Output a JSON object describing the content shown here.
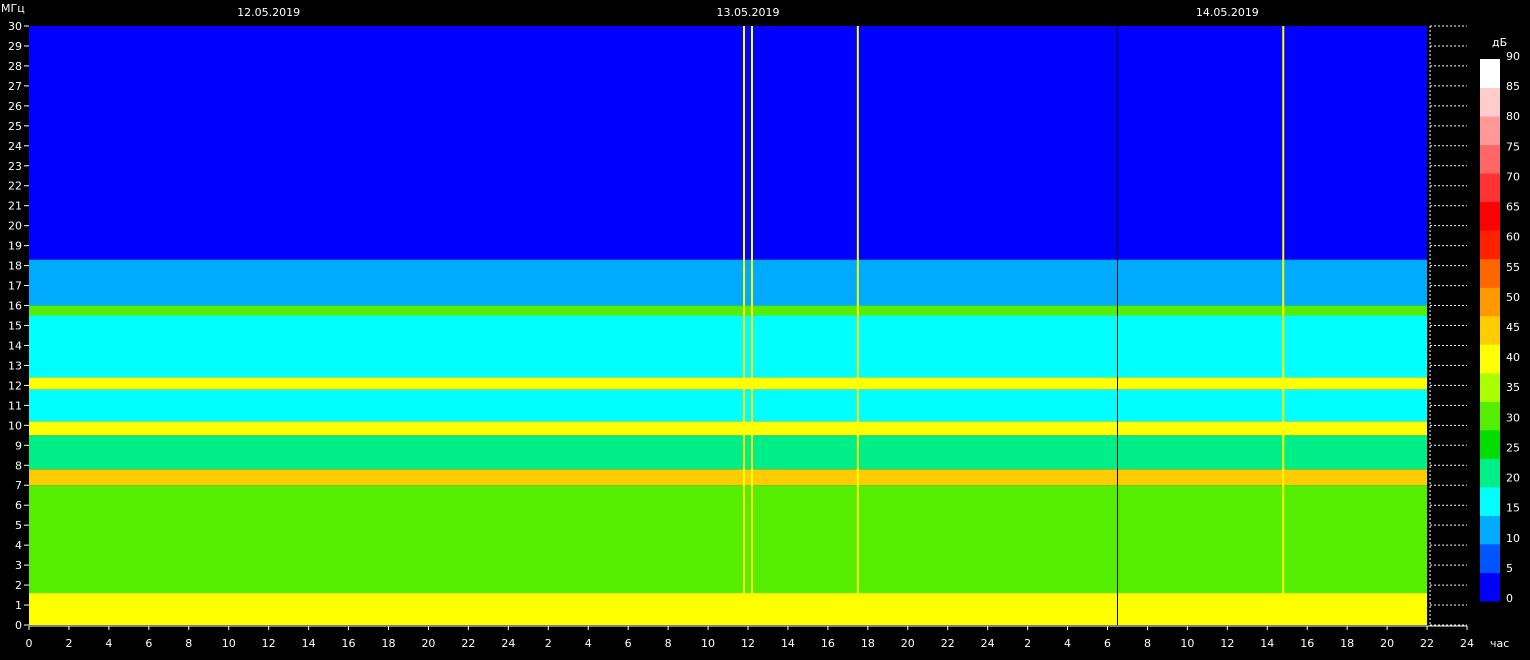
{
  "chart_data": {
    "type": "heatmap",
    "title": "",
    "y_unit": "МГц",
    "x_unit": "час",
    "colorbar_unit": "дБ",
    "dates": [
      {
        "label": "12.05.2019",
        "hour": 12
      },
      {
        "label": "13.05.2019",
        "hour": 36
      },
      {
        "label": "14.05.2019",
        "hour": 60
      }
    ],
    "x_range_hours": [
      0,
      72
    ],
    "data_end_hour": 70,
    "x_tick_labels": [
      "0",
      "2",
      "4",
      "6",
      "8",
      "10",
      "12",
      "14",
      "16",
      "18",
      "20",
      "22",
      "24",
      "2",
      "4",
      "6",
      "8",
      "10",
      "12",
      "14",
      "16",
      "18",
      "20",
      "22",
      "24",
      "2",
      "4",
      "6",
      "8",
      "10",
      "12",
      "14",
      "16",
      "18",
      "20",
      "22",
      "24"
    ],
    "y_range_mhz": [
      0,
      30
    ],
    "y_tick_labels": [
      "0",
      "1",
      "2",
      "3",
      "4",
      "5",
      "6",
      "7",
      "8",
      "9",
      "10",
      "11",
      "12",
      "13",
      "14",
      "15",
      "16",
      "17",
      "18",
      "19",
      "20",
      "21",
      "22",
      "23",
      "24",
      "25",
      "26",
      "27",
      "28",
      "29",
      "30"
    ],
    "colorbar": {
      "range_db": [
        0,
        90
      ],
      "tick_labels": [
        "0",
        "5",
        "10",
        "15",
        "20",
        "25",
        "30",
        "35",
        "40",
        "45",
        "50",
        "55",
        "60",
        "65",
        "70",
        "75",
        "80",
        "85",
        "90"
      ],
      "colors": [
        "#0000ff",
        "#0055ff",
        "#00aaff",
        "#00ffff",
        "#00ee88",
        "#00dd00",
        "#55ee00",
        "#aaff00",
        "#ffff00",
        "#ffcc00",
        "#ff9900",
        "#ff6600",
        "#ff2200",
        "#ff0000",
        "#ff3333",
        "#ff6666",
        "#ff9999",
        "#ffcccc",
        "#ffffff"
      ]
    },
    "bands": [
      {
        "f_lo": 0,
        "f_hi": 1.6,
        "level_db": 40
      },
      {
        "f_lo": 1.6,
        "f_hi": 7.0,
        "level_db": 30
      },
      {
        "f_lo": 7.0,
        "f_hi": 7.8,
        "level_db": 45
      },
      {
        "f_lo": 7.8,
        "f_hi": 9.5,
        "level_db": 22
      },
      {
        "f_lo": 9.5,
        "f_hi": 10.2,
        "level_db": 42
      },
      {
        "f_lo": 10.2,
        "f_hi": 11.8,
        "level_db": 17
      },
      {
        "f_lo": 11.8,
        "f_hi": 12.4,
        "level_db": 38
      },
      {
        "f_lo": 12.4,
        "f_hi": 15.5,
        "level_db": 15
      },
      {
        "f_lo": 15.5,
        "f_hi": 16.0,
        "level_db": 32
      },
      {
        "f_lo": 16.0,
        "f_hi": 18.3,
        "level_db": 8
      },
      {
        "f_lo": 18.3,
        "f_hi": 30,
        "level_db": 0
      }
    ],
    "vertical_lines_hours": [
      35.8,
      36.2,
      41.5,
      62.8
    ],
    "marker_line_hour": 54.5
  }
}
